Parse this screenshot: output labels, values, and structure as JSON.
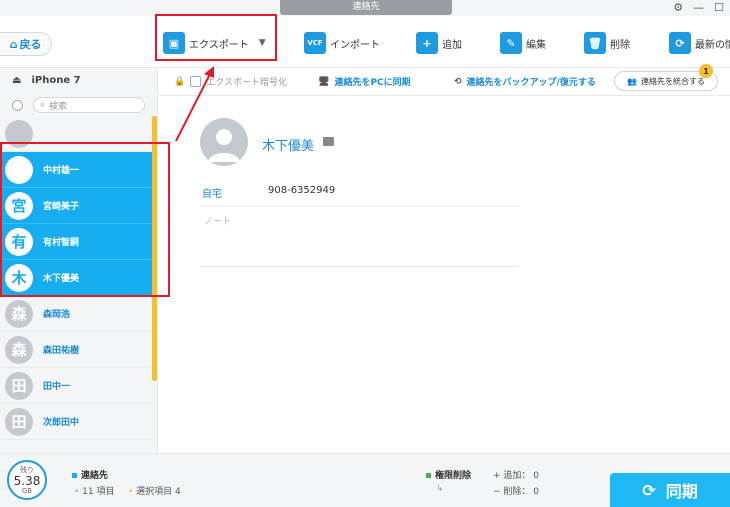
{
  "window": {
    "title": "連絡先"
  },
  "toolbar": {
    "back_label": "戻る",
    "export_label": "エクスポート",
    "import_label": "インポート",
    "add_label": "追加",
    "edit_label": "編集",
    "delete_label": "削除",
    "refresh_label": "最新の情"
  },
  "sidebar": {
    "device_name": "iPhone 7",
    "search_placeholder": "検索",
    "contacts": [
      {
        "name": "",
        "initial": "",
        "selected": false
      },
      {
        "name": "中村雄一",
        "initial": "",
        "selected": true
      },
      {
        "name": "宮崎美子",
        "initial": "宮",
        "selected": true
      },
      {
        "name": "有村智嗣",
        "initial": "有",
        "selected": true
      },
      {
        "name": "木下優美",
        "initial": "木",
        "selected": true
      },
      {
        "name": "森岡浩",
        "initial": "森",
        "selected": false
      },
      {
        "name": "森田祐樹",
        "initial": "森",
        "selected": false
      },
      {
        "name": "田中一",
        "initial": "田",
        "selected": false
      },
      {
        "name": "次郎田中",
        "initial": "田",
        "selected": false
      }
    ]
  },
  "subbar": {
    "encrypt_label": "エクスポート暗号化",
    "sync_pc_label": "連絡先をPCに同期",
    "backup_label": "連絡先をバックアップ/復元する",
    "merge_label": "連絡先を統合する",
    "merge_badge": "1"
  },
  "detail": {
    "name": "木下優美",
    "field_label": "自宅",
    "field_value": "908-6352949",
    "note_label": "ノート"
  },
  "footer": {
    "storage_top": "残り",
    "storage_value": "5.38",
    "storage_unit": "GB",
    "category": "連絡先",
    "item_count": "11 項目",
    "selected_count": "選択項目 4",
    "permission_label": "権限削除",
    "add_count": "+ 追加： 0",
    "delete_count": "− 削除： 0",
    "sync_label": "同期"
  },
  "colors": {
    "accent": "#16aef1",
    "highlight_red": "#e11c2a",
    "scroll": "#f5bf2f",
    "link": "#1a8bd6"
  }
}
